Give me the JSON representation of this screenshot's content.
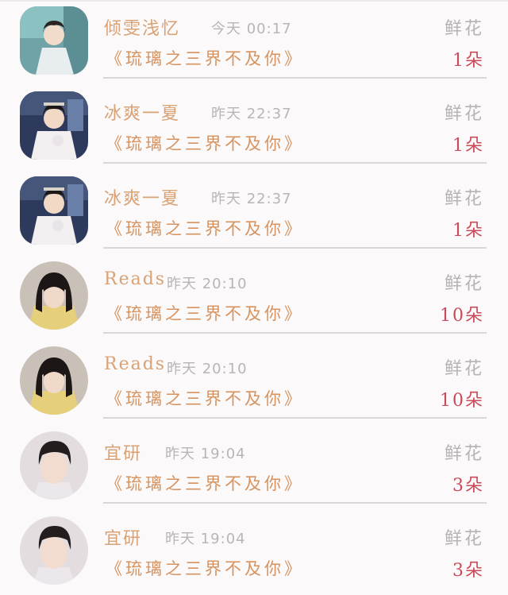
{
  "list": {
    "rows": [
      {
        "name": "倾雯浅忆",
        "time": "今天 00:17",
        "book": "《琉璃之三界不及你》",
        "gift_label": "鲜花",
        "count": "1朵",
        "avatar": "avatar-guqing"
      },
      {
        "name": "冰爽一夏",
        "time": "昨天 22:37",
        "book": "《琉璃之三界不及你》",
        "gift_label": "鲜花",
        "count": "1朵",
        "avatar": "avatar-cosplay"
      },
      {
        "name": "冰爽一夏",
        "time": "昨天 22:37",
        "book": "《琉璃之三界不及你》",
        "gift_label": "鲜花",
        "count": "1朵",
        "avatar": "avatar-cosplay"
      },
      {
        "name": "Reads",
        "time": "昨天 20:10",
        "book": "《琉璃之三界不及你》",
        "gift_label": "鲜花",
        "count": "10朵",
        "avatar": "avatar-girl"
      },
      {
        "name": "Reads",
        "time": "昨天 20:10",
        "book": "《琉璃之三界不及你》",
        "gift_label": "鲜花",
        "count": "10朵",
        "avatar": "avatar-girl"
      },
      {
        "name": "宜研",
        "time": "昨天 19:04",
        "book": "《琉璃之三界不及你》",
        "gift_label": "鲜花",
        "count": "3朵",
        "avatar": "avatar-boy"
      },
      {
        "name": "宜研",
        "time": "昨天 19:04",
        "book": "《琉璃之三界不及你》",
        "gift_label": "鲜花",
        "count": "3朵",
        "avatar": "avatar-boy"
      }
    ]
  },
  "colors": {
    "name": "#d9a275",
    "book": "#d6935f",
    "count": "#c94a5a",
    "muted": "#b7b3b3"
  }
}
